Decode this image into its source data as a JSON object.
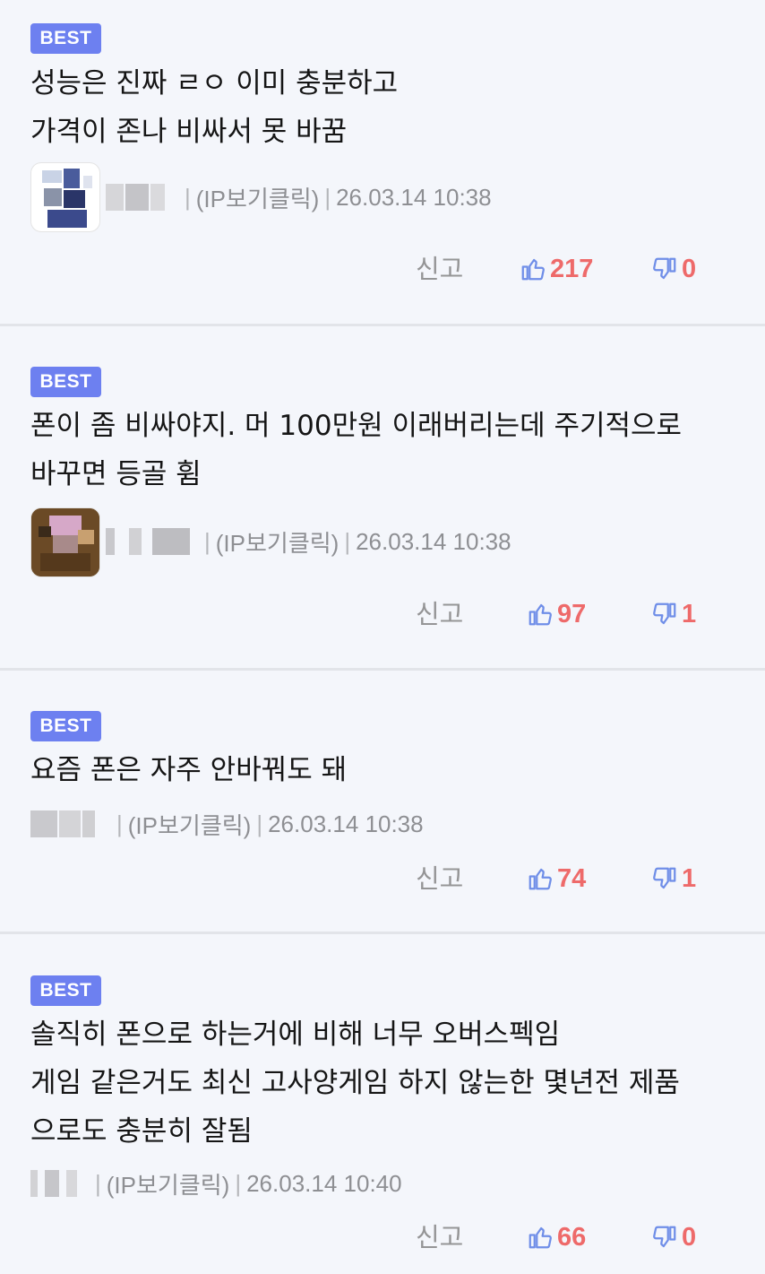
{
  "comments": [
    {
      "badge": "BEST",
      "text": "성능은 진짜 ㄹㅇ 이미 충분하고\n가격이 존나 비싸서 못 바꿈",
      "ip_label": "(IP보기클릭)",
      "timestamp": "26.03.14 10:38",
      "report_label": "신고",
      "upvotes": "217",
      "downvotes": "0"
    },
    {
      "badge": "BEST",
      "text": "폰이 좀 비싸야지. 머 100만원 이래버리는데 주기적으로\n바꾸면 등골 휨",
      "ip_label": "(IP보기클릭)",
      "timestamp": "26.03.14 10:38",
      "report_label": "신고",
      "upvotes": "97",
      "downvotes": "1"
    },
    {
      "badge": "BEST",
      "text": "요즘 폰은 자주 안바꿔도 돼",
      "ip_label": "(IP보기클릭)",
      "timestamp": "26.03.14 10:38",
      "report_label": "신고",
      "upvotes": "74",
      "downvotes": "1"
    },
    {
      "badge": "BEST",
      "text": "솔직히 폰으로 하는거에 비해 너무 오버스펙임\n게임 같은거도 최신 고사양게임 하지 않는한 몇년전 제품\n으로도 충분히 잘됨",
      "ip_label": "(IP보기클릭)",
      "timestamp": "26.03.14 10:40",
      "report_label": "신고",
      "upvotes": "66",
      "downvotes": "0"
    }
  ],
  "icons": {
    "upvote": "thumbs-up-icon",
    "downvote": "thumbs-down-icon"
  },
  "colors": {
    "badge": "#6d80f0",
    "vote_count": "#ee6a6a",
    "icon": "#6f8ee8",
    "background": "#f4f6fb"
  }
}
